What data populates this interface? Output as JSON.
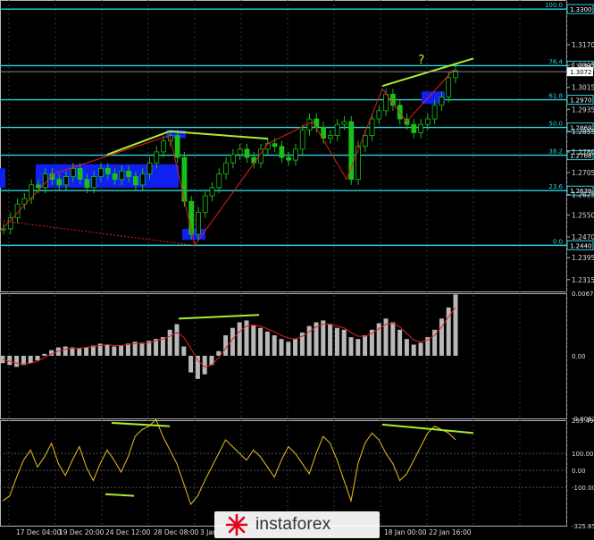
{
  "chart_data": [
    {
      "type": "line",
      "panel": "price",
      "ylim": [
        1.2285,
        1.332
      ],
      "y_ticks": [
        "1.3170",
        "1.3095",
        "1.3015",
        "1.2935",
        "1.2855",
        "1.2780",
        "1.2705",
        "1.2625",
        "1.2550",
        "1.2470",
        "1.2395",
        "1.2315"
      ],
      "fib_levels": [
        {
          "label": "100.0",
          "value": 1.33,
          "price_label": "1.3300"
        },
        {
          "label": "76.4",
          "value": 1.3094,
          "price_label": "1.3094"
        },
        {
          "label": "61.8",
          "value": 1.297,
          "price_label": "1.2970"
        },
        {
          "label": "50.0",
          "value": 1.2869,
          "price_label": "1.2869"
        },
        {
          "label": "38.2",
          "value": 1.2768,
          "price_label": "1.2768"
        },
        {
          "label": "23.6",
          "value": 1.2639,
          "price_label": "1.2639"
        },
        {
          "label": "0.0",
          "value": 1.244,
          "price_label": "1.2440"
        }
      ],
      "current_price": "1.3072",
      "annotations": [
        "?"
      ],
      "series": [
        {
          "values": [
            1.25,
            1.254,
            1.259,
            1.261,
            1.266,
            1.265,
            1.27,
            1.268,
            1.266,
            1.269,
            1.272,
            1.268,
            1.265,
            1.269,
            1.272,
            1.27,
            1.268,
            1.271,
            1.269,
            1.266,
            1.27,
            1.274,
            1.278,
            1.282,
            1.284,
            1.276,
            1.26,
            1.248,
            1.256,
            1.262,
            1.265,
            1.27,
            1.274,
            1.277,
            1.279,
            1.276,
            1.274,
            1.279,
            1.281,
            1.28,
            1.276,
            1.275,
            1.279,
            1.286,
            1.29,
            1.287,
            1.283,
            1.284,
            1.288,
            1.289,
            1.268,
            1.28,
            1.284,
            1.29,
            1.293,
            1.299,
            1.295,
            1.29,
            1.288,
            1.285,
            1.288,
            1.29,
            1.295,
            1.298,
            1.305,
            1.3075
          ]
        }
      ],
      "dates": [
        "17 Dec 04:00",
        "19 Dec 20:00",
        "24 Dec 12:00",
        "28 Dec 08:00",
        "3 Jan",
        "18 Jan 00:00",
        "22 Jan 16:00"
      ]
    },
    {
      "type": "bar",
      "panel": "macd",
      "ylim": [
        -0.00675,
        0.00673
      ],
      "y_ticks": [
        "0.00673",
        "0.00",
        "-0.00675"
      ],
      "values": [
        -0.0008,
        -0.001,
        -0.0012,
        -0.001,
        -0.0008,
        -0.0005,
        0.0002,
        0.0006,
        0.0009,
        0.001,
        0.0009,
        0.0008,
        0.0009,
        0.0011,
        0.0013,
        0.0012,
        0.001,
        0.0011,
        0.0013,
        0.0015,
        0.0014,
        0.0016,
        0.0018,
        0.002,
        0.0028,
        0.0034,
        0.001,
        -0.0018,
        -0.0025,
        -0.002,
        -0.001,
        0.0005,
        0.0022,
        0.003,
        0.0036,
        0.0038,
        0.0033,
        0.003,
        0.0026,
        0.0022,
        0.0018,
        0.0015,
        0.0018,
        0.0025,
        0.0032,
        0.0036,
        0.0038,
        0.0034,
        0.003,
        0.0028,
        0.002,
        0.0018,
        0.0022,
        0.0028,
        0.0035,
        0.004,
        0.0036,
        0.0028,
        0.0018,
        0.0012,
        0.0014,
        0.002,
        0.0028,
        0.004,
        0.0052,
        0.0066
      ],
      "signal": [
        -0.0004,
        -0.0006,
        -0.0008,
        -0.0009,
        -0.0008,
        -0.0006,
        -0.0002,
        0.0002,
        0.0005,
        0.0007,
        0.0008,
        0.0008,
        0.0009,
        0.001,
        0.0011,
        0.0012,
        0.0011,
        0.0011,
        0.0012,
        0.0013,
        0.0013,
        0.0014,
        0.0016,
        0.0018,
        0.0021,
        0.0025,
        0.002,
        0.0008,
        -0.0005,
        -0.0012,
        -0.001,
        -0.0002,
        0.0008,
        0.0018,
        0.0026,
        0.0032,
        0.0033,
        0.0032,
        0.0029,
        0.0026,
        0.0022,
        0.0019,
        0.0018,
        0.0021,
        0.0026,
        0.0031,
        0.0034,
        0.0034,
        0.0032,
        0.003,
        0.0025,
        0.0021,
        0.0021,
        0.0024,
        0.0029,
        0.0034,
        0.0035,
        0.0031,
        0.0024,
        0.0017,
        0.0015,
        0.0017,
        0.0022,
        0.0031,
        0.0042,
        0.0052
      ]
    },
    {
      "type": "line",
      "panel": "cci",
      "ylim": [
        -325.653,
        295.4989
      ],
      "y_ticks": [
        "295.4989",
        "100.00",
        "0.00",
        "-100.00",
        "-325.6530"
      ],
      "values": [
        -180,
        -150,
        -40,
        60,
        120,
        20,
        80,
        160,
        40,
        -30,
        60,
        140,
        20,
        -60,
        40,
        120,
        60,
        -10,
        80,
        200,
        240,
        260,
        300,
        200,
        120,
        40,
        -80,
        -200,
        -150,
        -60,
        20,
        100,
        180,
        140,
        100,
        60,
        120,
        80,
        20,
        -40,
        60,
        140,
        100,
        40,
        -20,
        100,
        200,
        160,
        60,
        -60,
        -180,
        40,
        160,
        220,
        180,
        100,
        40,
        -60,
        -20,
        60,
        140,
        220,
        260,
        240,
        220,
        180
      ]
    }
  ],
  "branding": {
    "watermark": "instaforex"
  }
}
